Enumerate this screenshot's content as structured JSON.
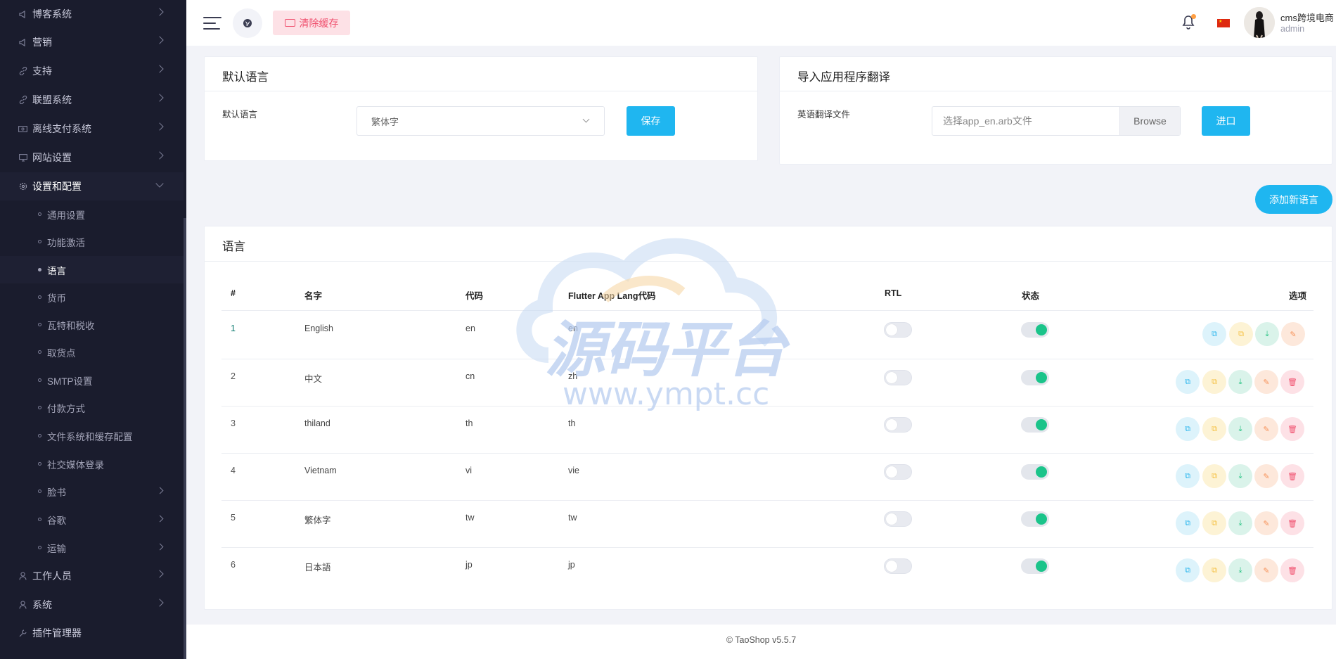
{
  "sidebar": {
    "items": [
      {
        "label": "博客系统",
        "icon": "megaphone-icon"
      },
      {
        "label": "营销",
        "icon": "megaphone-icon"
      },
      {
        "label": "支持",
        "icon": "link-icon"
      },
      {
        "label": "联盟系统",
        "icon": "link-icon"
      },
      {
        "label": "离线支付系统",
        "icon": "money-icon"
      },
      {
        "label": "网站设置",
        "icon": "monitor-icon"
      },
      {
        "label": "设置和配置",
        "icon": "gear-icon"
      }
    ],
    "sub_items": [
      {
        "label": "通用设置"
      },
      {
        "label": "功能激活"
      },
      {
        "label": "语言"
      },
      {
        "label": "货币"
      },
      {
        "label": "瓦特和税收"
      },
      {
        "label": "取货点"
      },
      {
        "label": "SMTP设置"
      },
      {
        "label": "付款方式"
      },
      {
        "label": "文件系统和缓存配置"
      },
      {
        "label": "社交媒体登录"
      },
      {
        "label": "脸书"
      },
      {
        "label": "谷歌"
      },
      {
        "label": "运输"
      }
    ],
    "bottom_items": [
      {
        "label": "工作人员",
        "icon": "user-icon"
      },
      {
        "label": "系统",
        "icon": "user-icon"
      },
      {
        "label": "插件管理器",
        "icon": "wrench-icon"
      }
    ]
  },
  "header": {
    "clear_cache_label": "清除缓存",
    "user_name": "cms跨境电商",
    "user_role": "admin"
  },
  "default_language": {
    "title": "默认语言",
    "field_label": "默认语言",
    "selected": "繁体字",
    "save_label": "保存"
  },
  "import_translation": {
    "title": "导入应用程序翻译",
    "field_label": "英语翻译文件",
    "placeholder": "选择app_en.arb文件",
    "browse_label": "Browse",
    "import_label": "进口"
  },
  "add_language_label": "添加新语言",
  "languages": {
    "title": "语言",
    "columns": [
      "#",
      "名字",
      "代码",
      "Flutter App Lang代码",
      "RTL",
      "状态",
      "选项"
    ],
    "rows": [
      {
        "num": "1",
        "name": "English",
        "code": "en",
        "app_code": "en",
        "rtl": false,
        "status": true
      },
      {
        "num": "2",
        "name": "中文",
        "code": "cn",
        "app_code": "zh",
        "rtl": false,
        "status": true
      },
      {
        "num": "3",
        "name": "thiland",
        "code": "th",
        "app_code": "th",
        "rtl": false,
        "status": true
      },
      {
        "num": "4",
        "name": "Vietnam",
        "code": "vi",
        "app_code": "vie",
        "rtl": false,
        "status": true
      },
      {
        "num": "5",
        "name": "繁体字",
        "code": "tw",
        "app_code": "tw",
        "rtl": false,
        "status": true
      },
      {
        "num": "6",
        "name": "日本語",
        "code": "jp",
        "app_code": "jp",
        "rtl": false,
        "status": true
      }
    ]
  },
  "watermark": {
    "title": "源码平台",
    "url": "www.ympt.cc"
  },
  "footer": {
    "text": "© TaoShop v5.5.7"
  },
  "colors": {
    "accent": "#1fb6f0",
    "sidebar_bg": "#1a1c2d",
    "danger": "#f0506e",
    "success": "#1bc48a"
  }
}
